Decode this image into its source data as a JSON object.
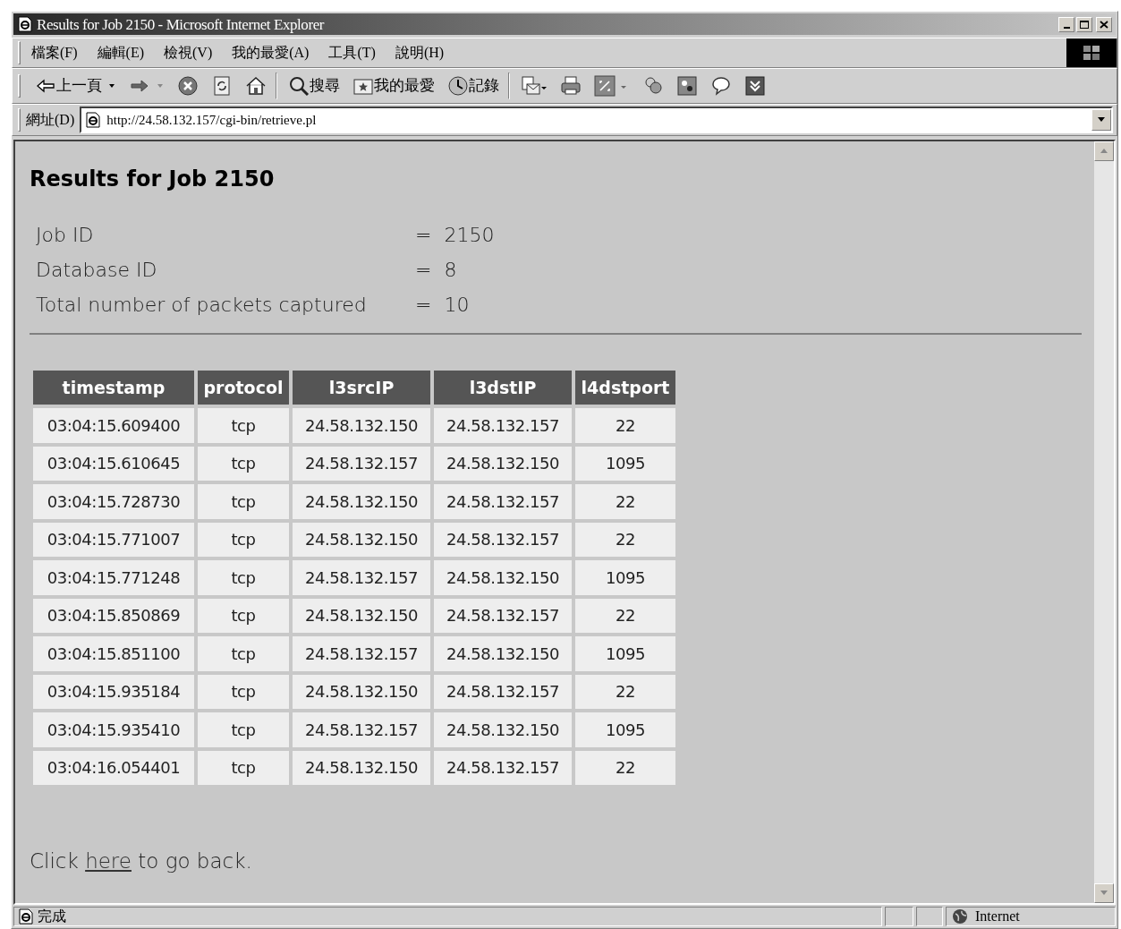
{
  "window": {
    "title": "Results for Job 2150 - Microsoft Internet Explorer"
  },
  "menu": [
    "檔案(F)",
    "編輯(E)",
    "檢視(V)",
    "我的最愛(A)",
    "工具(T)",
    "說明(H)"
  ],
  "toolbar": [
    {
      "kind": "back",
      "label": "上一頁"
    },
    {
      "kind": "forward"
    },
    {
      "kind": "stop"
    },
    {
      "kind": "refresh"
    },
    {
      "kind": "home"
    },
    {
      "kind": "search",
      "label": "搜尋"
    },
    {
      "kind": "favorites",
      "label": "我的最愛"
    },
    {
      "kind": "history",
      "label": "記錄"
    },
    {
      "kind": "mail"
    },
    {
      "kind": "print"
    },
    {
      "kind": "edit"
    },
    {
      "kind": "discuss"
    },
    {
      "kind": "messenger"
    },
    {
      "kind": "chat"
    },
    {
      "kind": "media"
    }
  ],
  "address": {
    "label": "網址(D)",
    "url": "http://24.58.132.157/cgi-bin/retrieve.pl"
  },
  "page": {
    "heading": "Results for Job 2150",
    "summary": [
      {
        "label": "Job ID",
        "sign": "=",
        "value": "2150"
      },
      {
        "label": "Database ID",
        "sign": "=",
        "value": "8"
      },
      {
        "label": "Total number of packets captured",
        "sign": "=",
        "value": "10"
      }
    ],
    "table": {
      "columns": [
        "timestamp",
        "protocol",
        "l3srcIP",
        "l3dstIP",
        "l4dstport"
      ],
      "rows": [
        [
          "03:04:15.609400",
          "tcp",
          "24.58.132.150",
          "24.58.132.157",
          "22"
        ],
        [
          "03:04:15.610645",
          "tcp",
          "24.58.132.157",
          "24.58.132.150",
          "1095"
        ],
        [
          "03:04:15.728730",
          "tcp",
          "24.58.132.150",
          "24.58.132.157",
          "22"
        ],
        [
          "03:04:15.771007",
          "tcp",
          "24.58.132.150",
          "24.58.132.157",
          "22"
        ],
        [
          "03:04:15.771248",
          "tcp",
          "24.58.132.157",
          "24.58.132.150",
          "1095"
        ],
        [
          "03:04:15.850869",
          "tcp",
          "24.58.132.150",
          "24.58.132.157",
          "22"
        ],
        [
          "03:04:15.851100",
          "tcp",
          "24.58.132.157",
          "24.58.132.150",
          "1095"
        ],
        [
          "03:04:15.935184",
          "tcp",
          "24.58.132.150",
          "24.58.132.157",
          "22"
        ],
        [
          "03:04:15.935410",
          "tcp",
          "24.58.132.157",
          "24.58.132.150",
          "1095"
        ],
        [
          "03:04:16.054401",
          "tcp",
          "24.58.132.150",
          "24.58.132.157",
          "22"
        ]
      ]
    },
    "footer": {
      "before": "Click",
      "link": "here",
      "after": "to go back."
    }
  },
  "status_bar": {
    "text": "完成",
    "zone": "Internet"
  }
}
